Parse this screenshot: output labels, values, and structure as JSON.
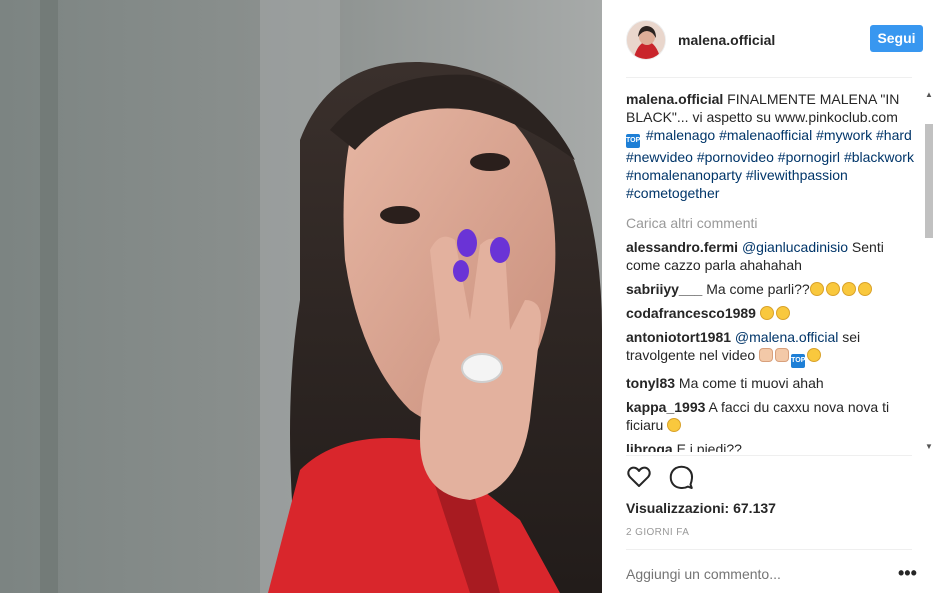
{
  "post": {
    "username": "malena.official",
    "follow_label": "Segui",
    "caption": {
      "user": "malena.official",
      "text": "FINALMENTE MALENA \"IN BLACK\"... vi aspetto su www.pinkoclub.com",
      "badge": "TOP",
      "hashtags": [
        "#malenago",
        "#malenaofficial",
        "#mywork",
        "#hard",
        "#newvideo",
        "#pornovideo",
        "#pornogirl",
        "#blackwork",
        "#nomalenanoparty",
        "#livewithpassion",
        "#cometogether"
      ]
    },
    "load_more_label": "Carica altri commenti",
    "comments": [
      {
        "user": "alessandro.fermi",
        "mention": "@gianlucadinisio",
        "text": "Senti come cazzo parla ahahahah"
      },
      {
        "user": "sabriiyy___",
        "text": "Ma come parli??",
        "emoji": [
          "laugh",
          "laugh",
          "laugh",
          "laugh"
        ]
      },
      {
        "user": "codafrancesco1989",
        "text": "",
        "emoji": [
          "heart-eyes",
          "kiss"
        ]
      },
      {
        "user": "antoniotort1981",
        "mention": "@malena.official",
        "text": "sei travolgente nel video",
        "emoji": [
          "clap",
          "clap",
          "top-badge",
          "flushed"
        ]
      },
      {
        "user": "tonyl83",
        "text": "Ma come ti muovi ahah"
      },
      {
        "user": "kappa_1993",
        "text": "A facci du caxxu nova nova ti ficiaru",
        "emoji": [
          "laugh"
        ]
      },
      {
        "user": "libroga",
        "text": "E i piedi??"
      }
    ],
    "views_label": "Visualizzazioni:",
    "views_count": "67.137",
    "timestamp": "2 GIORNI FA",
    "add_comment_placeholder": "Aggiungi un commento...",
    "more_options": "•••",
    "icons": {
      "like": "heart-outline-icon",
      "comment": "speech-bubble-icon",
      "options": "ellipsis-icon"
    },
    "colors": {
      "follow": "#3897f0",
      "hashtag": "#003569",
      "muted": "#999999"
    }
  }
}
